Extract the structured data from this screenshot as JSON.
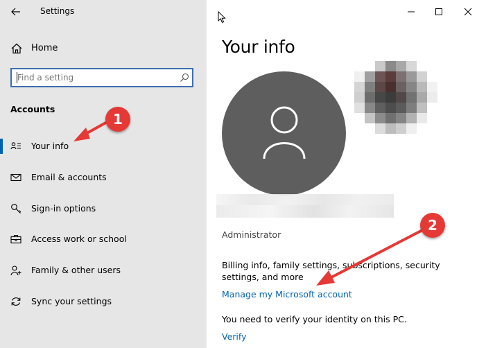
{
  "window": {
    "app_title": "Settings"
  },
  "sidebar": {
    "home_label": "Home",
    "search_placeholder": "Find a setting",
    "section_heading": "Accounts",
    "items": [
      {
        "label": "Your info",
        "icon": "person-card-icon",
        "selected": true
      },
      {
        "label": "Email & accounts",
        "icon": "envelope-icon"
      },
      {
        "label": "Sign-in options",
        "icon": "key-icon"
      },
      {
        "label": "Access work or school",
        "icon": "briefcase-icon"
      },
      {
        "label": "Family & other users",
        "icon": "person-add-icon"
      },
      {
        "label": "Sync your settings",
        "icon": "sync-icon"
      }
    ]
  },
  "main": {
    "title": "Your info",
    "role": "Administrator",
    "billing_text": "Billing info, family settings, subscriptions, security settings, and more",
    "manage_link": "Manage my Microsoft account",
    "verify_text": "You need to verify your identity on this PC.",
    "verify_link": "Verify"
  },
  "annotations": {
    "badge_1": "1",
    "badge_2": "2",
    "color": "#e53935"
  },
  "colors": {
    "accent": "#0063b1",
    "sidebar_bg": "#e6e6e6",
    "avatar_bg": "#5e5e5e"
  }
}
